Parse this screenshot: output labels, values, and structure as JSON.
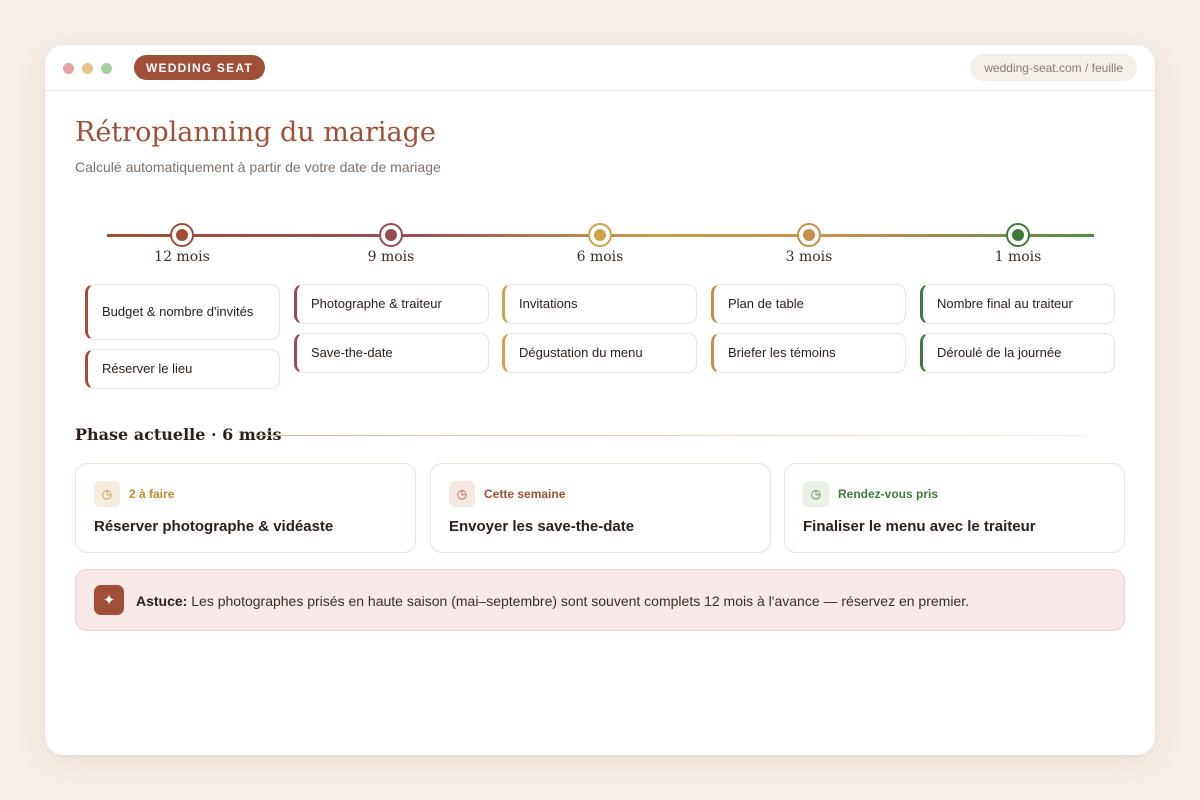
{
  "window": {
    "brand": "WEDDING SEAT",
    "url": "wedding-seat.com / feuille"
  },
  "header": {
    "title": "Rétroplanning du mariage",
    "subtitle": "Calculé automatiquement à partir de votre date de mariage"
  },
  "timeline": {
    "milestones": [
      {
        "label": "12 mois",
        "color": "#a04e37",
        "tasks": [
          "Budget & nombre d'invités",
          "Réserver le lieu"
        ]
      },
      {
        "label": "9 mois",
        "color": "#9a4a55",
        "tasks": [
          "Photographe & traiteur",
          "Save-the-date"
        ]
      },
      {
        "label": "6 mois",
        "color": "#d1a349",
        "tasks": [
          "Invitations",
          "Dégustation du menu"
        ]
      },
      {
        "label": "3 mois",
        "color": "#c98f4a",
        "tasks": [
          "Plan de table",
          "Briefer les témoins"
        ]
      },
      {
        "label": "1 mois",
        "color": "#3f7a3c",
        "tasks": [
          "Nombre final au traiteur",
          "Déroulé de la journée"
        ]
      }
    ]
  },
  "phase": {
    "title": "Phase actuelle · 6 mois",
    "cards": [
      {
        "icon": "clock-icon",
        "tag": "2 à faire",
        "tag_color": "#c38a2a",
        "icon_bg": "#f5ece0",
        "text": "Réserver photographe & vidéaste"
      },
      {
        "icon": "clock-icon",
        "tag": "Cette semaine",
        "tag_color": "#a04e37",
        "icon_bg": "#f5e8e2",
        "text": "Envoyer les save-the-date"
      },
      {
        "icon": "clock-icon",
        "tag": "Rendez-vous pris",
        "tag_color": "#3f7a3c",
        "icon_bg": "#eaf1e6",
        "text": "Finaliser le menu avec le traiteur"
      }
    ]
  },
  "tip": {
    "icon": "sparkle-icon",
    "label": "Astuce:",
    "text": "Les photographes prisés en haute saison (mai–septembre) sont souvent complets 12 mois à l'avance — réservez en premier."
  }
}
